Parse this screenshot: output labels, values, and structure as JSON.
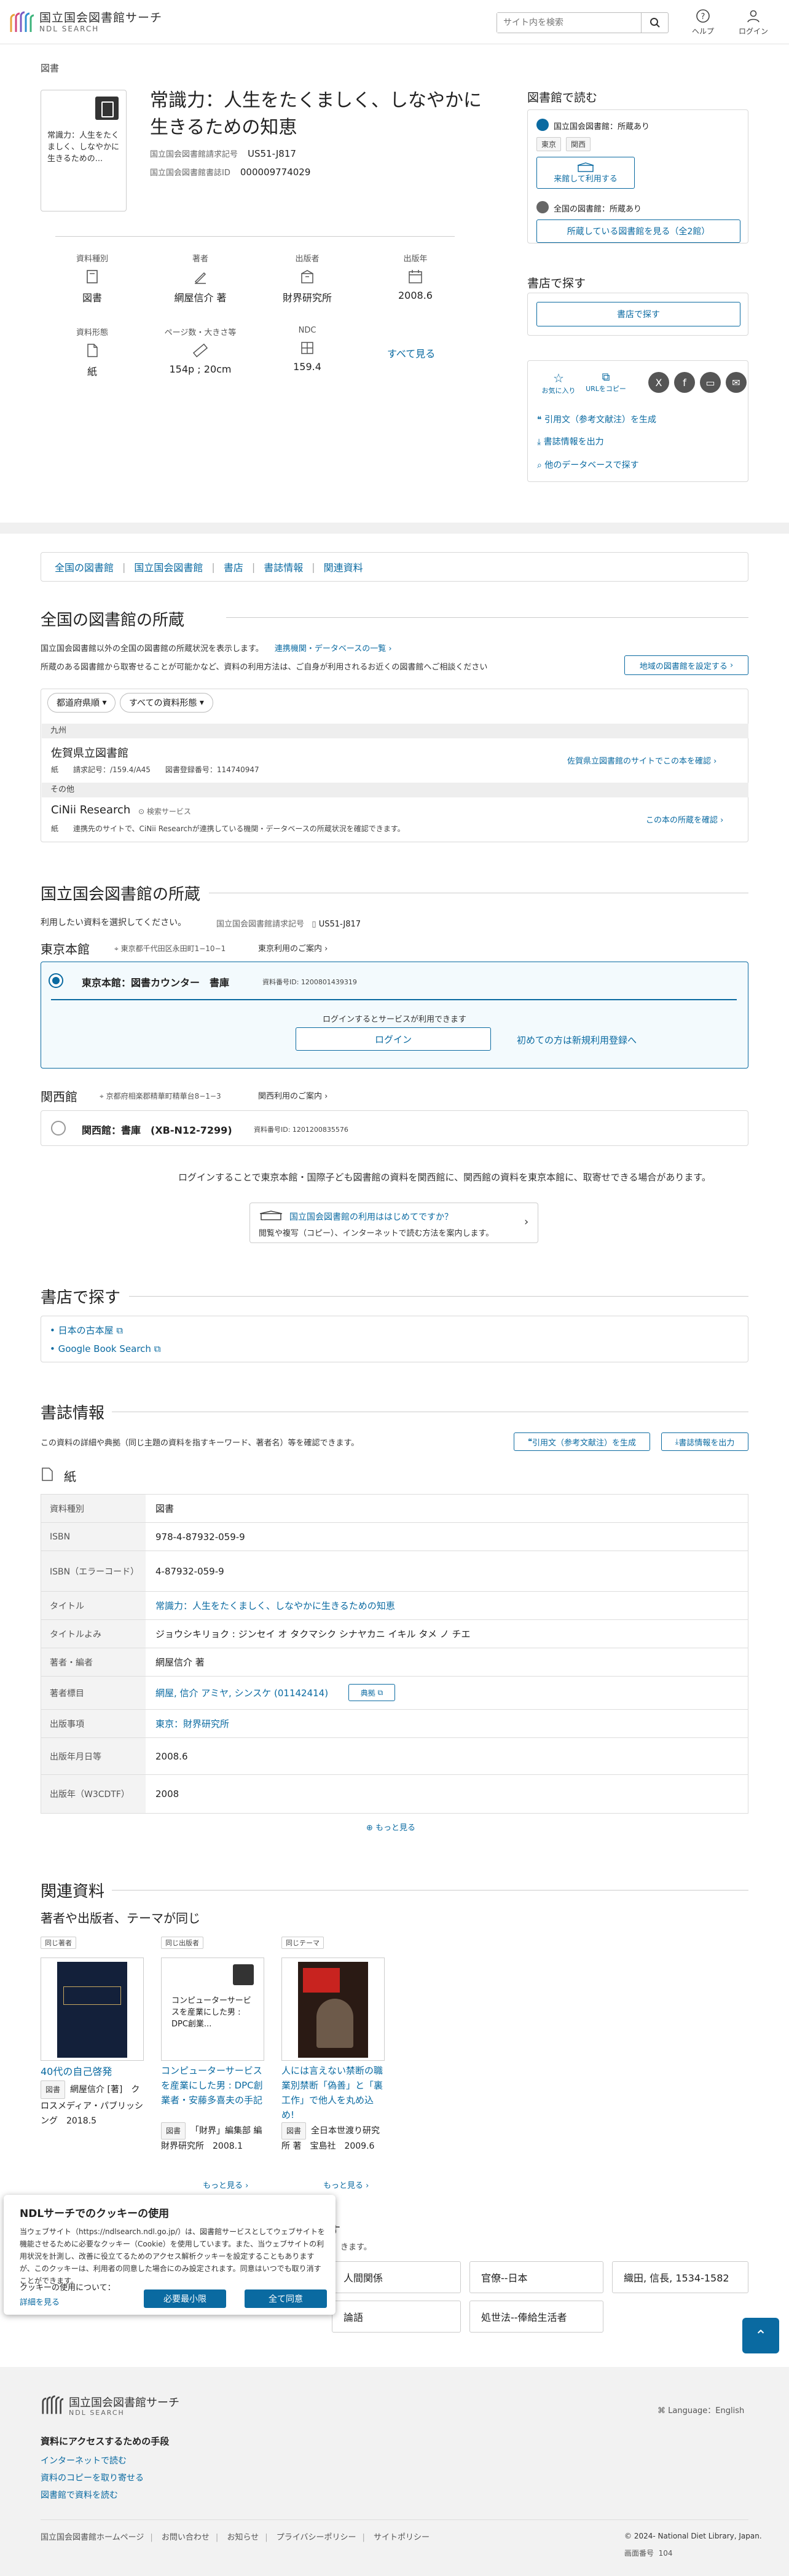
{
  "header": {
    "logo_main": "国立国会図書館サーチ",
    "logo_sub": "NDL SEARCH",
    "search_placeholder": "サイト内を検索",
    "help_label": "ヘルプ",
    "login_label": "ログイン"
  },
  "record": {
    "breadcrumb": "図書",
    "cover_text": "常識力：人生をたくましく、しなやかに生きるための...",
    "title": "常識力：人生をたくましく、しなやかに生きるための知恵",
    "call_no_label": "国立国会図書館請求記号",
    "call_no": "US51-J817",
    "bib_id_label": "国立国会図書館書誌ID",
    "bib_id": "000009774029",
    "info": [
      {
        "label": "資料種別",
        "value": "図書",
        "icon": "book-type-icon"
      },
      {
        "label": "著者",
        "value": "網屋信介 著",
        "icon": "author-icon"
      },
      {
        "label": "出版者",
        "value": "財界研究所",
        "icon": "publisher-icon"
      },
      {
        "label": "出版年",
        "value": "2008.6",
        "icon": "calendar-icon"
      },
      {
        "label": "資料形態",
        "value": "紙",
        "icon": "paper-icon"
      },
      {
        "label": "ページ数・大きさ等",
        "value": "154p ; 20cm",
        "icon": "ruler-icon"
      },
      {
        "label": "NDC",
        "value": "159.4",
        "icon": "ndc-icon"
      }
    ],
    "see_all": "すべて見る"
  },
  "side": {
    "read_heading": "図書館で読む",
    "ndl_owned": "国立国会図書館：所蔵あり",
    "tag_tokyo": "東京",
    "tag_kansai": "関西",
    "visit_btn": "来館して利用する",
    "national_owned": "全国の図書館：所蔵あり",
    "see_libraries_btn": "所蔵している図書館を見る（全2館）",
    "store_heading": "書店で探す",
    "store_btn": "書店で探す",
    "fav_label": "お気に入り",
    "url_copy_label": "URLをコピー",
    "cite_link": "引用文（参考文献注）を生成",
    "export_link": "書誌情報を出力",
    "other_db_link": "他のデータベースで探す"
  },
  "nav": [
    "全国の図書館",
    "国立国会図書館",
    "書店",
    "書誌情報",
    "関連資料"
  ],
  "holdings": {
    "heading": "全国の図書館の所蔵",
    "desc1": "国立国会図書館以外の全国の図書館の所蔵状況を表示します。",
    "desc1_link": "連携機関・データベースの一覧",
    "desc2": "所蔵のある図書館から取寄せることが可能かなど、資料の利用方法は、ご自身が利用されるお近くの図書館へご相談ください",
    "set_region_btn": "地域の図書館を設定する",
    "filter_pref": "都道府県順",
    "filter_type": "すべての資料形態",
    "region1": "九州",
    "lib1_name": "佐賀県立図書館",
    "lib1_meta": "紙　　請求記号：/159.4/A45　　図書登録番号：114740947",
    "lib1_link": "佐賀県立図書館のサイトでこの本を確認",
    "region2": "その他",
    "lib2_name": "CiNii Research",
    "lib2_badge": "検索サービス",
    "lib2_meta": "紙　　連携先のサイトで、CiNii Researchが連携している機関・データベースの所蔵状況を確認できます。",
    "lib2_link": "この本の所蔵を確認"
  },
  "ndl": {
    "heading": "国立国会図書館の所蔵",
    "select_text": "利用したい資料を選択してください。",
    "call_no_label": "国立国会図書館請求記号",
    "call_no": "US51-J817",
    "tokyo_heading": "東京本館",
    "tokyo_address": "東京都千代田区永田町1−10−1",
    "tokyo_guide": "東京利用のご案内",
    "tokyo_item": "東京本館：図書カウンター　書庫",
    "tokyo_item_id": "資料番号ID: 1200801439319",
    "login_note": "ログインするとサービスが利用できます",
    "login_btn": "ログイン",
    "register_link": "初めての方は新規利用登録へ",
    "kansai_heading": "関西館",
    "kansai_address": "京都府相楽郡精華町精華台8−1−3",
    "kansai_guide": "関西利用のご案内",
    "kansai_item": "関西館：書庫　(XB-N12-7299)",
    "kansai_item_id": "資料番号ID: 1201200835576",
    "login_transfer_note": "ログインすることで東京本館・国際子ども図書館の資料を関西館に、関西館の資料を東京本館に、取寄せできる場合があります。",
    "first_time_title": "国立国会図書館の利用ははじめてですか？",
    "first_time_desc": "閲覧や複写（コピー）、インターネットで読む方法を案内します。"
  },
  "bookstore": {
    "heading": "書店で探す",
    "links": [
      "日本の古本屋",
      "Google Book Search"
    ]
  },
  "bib": {
    "heading": "書誌情報",
    "desc": "この資料の詳細や典拠（同じ主題の資料を指すキーワード、著者名）等を確認できます。",
    "cite_btn": "引用文（参考文献注）を生成",
    "export_btn": "書誌情報を出力",
    "form_label": "紙",
    "rows": [
      {
        "k": "資料種別",
        "v": "図書"
      },
      {
        "k": "ISBN",
        "v": "978-4-87932-059-9"
      },
      {
        "k": "ISBN（エラーコード）",
        "v": "4-87932-059-9"
      },
      {
        "k": "タイトル",
        "v": "常識力：人生をたくましく、しなやかに生きるための知恵"
      },
      {
        "k": "タイトルよみ",
        "v": "ジョウシキリョク : ジンセイ オ タクマシク シナヤカニ イキル タメ ノ チエ"
      },
      {
        "k": "著者・編者",
        "v": "網屋信介 著"
      },
      {
        "k": "著者標目",
        "v": "網屋, 信介 アミヤ, シンスケ (01142414)"
      },
      {
        "k": "出版事項",
        "v": "東京：財界研究所"
      },
      {
        "k": "出版年月日等",
        "v": "2008.6"
      },
      {
        "k": "出版年（W3CDTF）",
        "v": "2008"
      }
    ],
    "authority_btn": "典拠",
    "more": "もっと見る"
  },
  "related": {
    "heading": "関連資料",
    "sub": "著者や出版者、テーマが同じ",
    "items": [
      {
        "tag": "同じ著者",
        "title": "40代の自己啓発",
        "type": "図書",
        "meta": "網屋信介 [著]　クロスメディア・パブリッシング　2018.5"
      },
      {
        "tag": "同じ出版者",
        "title": "コンピューターサービスを産業にした男 : DPC創業者・安藤多喜夫の手記",
        "type": "図書",
        "meta": "「財界」編集部 編　財界研究所　2008.1",
        "thumb_text": "コンピューターサービスを産業にした男 : DPC創業..."
      },
      {
        "tag": "同じテーマ",
        "title": "人には言えない禁断の職業別禁断「偽善」と「裏工作」で他人を丸め込め!",
        "type": "図書",
        "meta": "全日本世渡り研究所 著　宝島社　2009.6"
      }
    ],
    "more1": "もっと見る",
    "more2": "もっと見る",
    "subject_heading_tail": "す",
    "subject_desc_tail": "きます。",
    "subjects": [
      "人間関係",
      "官僚--日本",
      "織田, 信長, 1534-1582",
      "論語",
      "処世法--俸給生活者"
    ]
  },
  "cookie": {
    "title": "NDLサーチでのクッキーの使用",
    "body": "当ウェブサイト（https://ndlsearch.ndl.go.jp/）は、図書館サービスとしてウェブサイトを機能させるために必要なクッキー（Cookie）を使用しています。また、当ウェブサイトの利用状況を計測し、改善に役立てるためのアクセス解析クッキーを設定することもありますが、このクッキーは、利用者の同意した場合にのみ設定されます。同意はいつでも取り消すことができます。",
    "more_label": "クッキーの使用について：",
    "more_link": "詳細を見る",
    "necessary_btn": "必要最小限",
    "accept_btn": "全て同意"
  },
  "footer": {
    "logo_main": "国立国会図書館サーチ",
    "logo_sub": "NDL SEARCH",
    "language": "Language：English",
    "access_heading": "資料にアクセスするための手段",
    "access_links": [
      "インターネットで読む",
      "資料のコピーを取り寄せる",
      "図書館で資料を読む"
    ],
    "bottom_links": [
      "国立国会図書館ホームページ",
      "お問い合わせ",
      "お知らせ",
      "プライバシーポリシー",
      "サイトポリシー"
    ],
    "copyright": "© 2024- National Diet Library, Japan.",
    "screen_no_label": "画面番号",
    "screen_no": "104"
  },
  "colors": {
    "accent": "#0a6aa1",
    "panel_bg": "#f3fafd"
  }
}
